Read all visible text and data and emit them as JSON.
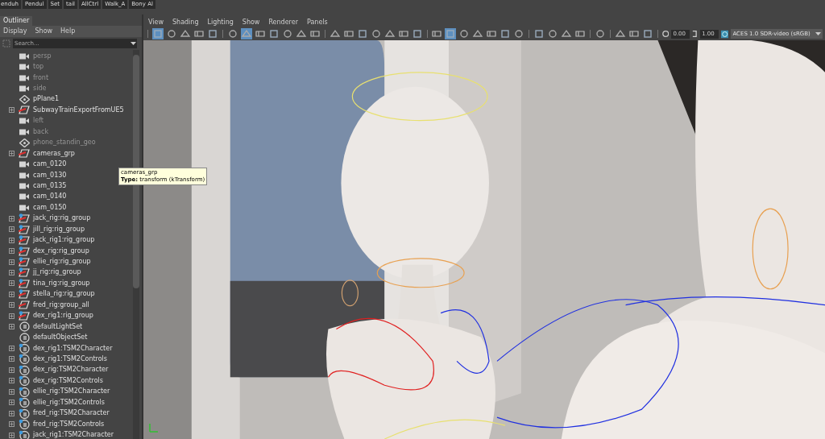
{
  "shelf": [
    "enduh",
    "Pendul",
    "Set",
    "tail",
    "AllCtrl",
    "Walk_A",
    "Bony Al"
  ],
  "outliner": {
    "tab": "Outliner",
    "menu": [
      "Display",
      "Show",
      "Help"
    ],
    "search": {
      "placeholder": "Search..."
    },
    "items": [
      {
        "label": "persp",
        "kind": "camera",
        "dimmed": true,
        "expandable": false
      },
      {
        "label": "top",
        "kind": "camera",
        "dimmed": true,
        "expandable": false
      },
      {
        "label": "front",
        "kind": "camera",
        "dimmed": true,
        "expandable": false
      },
      {
        "label": "side",
        "kind": "camera",
        "dimmed": true,
        "expandable": false
      },
      {
        "label": "pPlane1",
        "kind": "mesh",
        "dimmed": false,
        "expandable": false
      },
      {
        "label": "SubwayTrainExportFromUE5",
        "kind": "group",
        "dimmed": false,
        "expandable": true
      },
      {
        "label": "left",
        "kind": "camera",
        "dimmed": true,
        "expandable": false
      },
      {
        "label": "back",
        "kind": "camera",
        "dimmed": true,
        "expandable": false
      },
      {
        "label": "phone_standin_geo",
        "kind": "mesh",
        "dimmed": true,
        "expandable": false
      },
      {
        "label": "cameras_grp",
        "kind": "group",
        "dimmed": false,
        "expandable": true
      },
      {
        "label": "cam_0120",
        "kind": "camera",
        "dimmed": false,
        "expandable": false
      },
      {
        "label": "cam_0130",
        "kind": "camera",
        "dimmed": false,
        "expandable": false
      },
      {
        "label": "cam_0135",
        "kind": "camera",
        "dimmed": false,
        "expandable": false
      },
      {
        "label": "cam_0140",
        "kind": "camera",
        "dimmed": false,
        "expandable": false
      },
      {
        "label": "cam_0150",
        "kind": "camera",
        "dimmed": false,
        "expandable": false
      },
      {
        "label": "jack_rig:rig_group",
        "kind": "rig",
        "dimmed": false,
        "expandable": true
      },
      {
        "label": "jill_rig:rig_group",
        "kind": "rig",
        "dimmed": false,
        "expandable": true
      },
      {
        "label": "jack_rig1:rig_group",
        "kind": "rig",
        "dimmed": false,
        "expandable": true
      },
      {
        "label": "dex_rig:rig_group",
        "kind": "rig",
        "dimmed": false,
        "expandable": true
      },
      {
        "label": "ellie_rig:rig_group",
        "kind": "rig",
        "dimmed": false,
        "expandable": true
      },
      {
        "label": "jj_rig:rig_group",
        "kind": "rig",
        "dimmed": false,
        "expandable": true
      },
      {
        "label": "tina_rig:rig_group",
        "kind": "rig",
        "dimmed": false,
        "expandable": true
      },
      {
        "label": "stella_rig:rig_group",
        "kind": "rig",
        "dimmed": false,
        "expandable": true
      },
      {
        "label": "fred_rig:group_all",
        "kind": "group",
        "dimmed": false,
        "expandable": true
      },
      {
        "label": "dex_rig1:rig_group",
        "kind": "rig",
        "dimmed": false,
        "expandable": true
      },
      {
        "label": "defaultLightSet",
        "kind": "set",
        "dimmed": false,
        "expandable": true
      },
      {
        "label": "defaultObjectSet",
        "kind": "set",
        "dimmed": false,
        "expandable": false
      },
      {
        "label": "dex_rig1:TSM2Character",
        "kind": "refset",
        "dimmed": false,
        "expandable": true
      },
      {
        "label": "dex_rig1:TSM2Controls",
        "kind": "refset",
        "dimmed": false,
        "expandable": true
      },
      {
        "label": "dex_rig:TSM2Character",
        "kind": "refset",
        "dimmed": false,
        "expandable": true
      },
      {
        "label": "dex_rig:TSM2Controls",
        "kind": "refset",
        "dimmed": false,
        "expandable": true
      },
      {
        "label": "ellie_rig:TSM2Character",
        "kind": "refset",
        "dimmed": false,
        "expandable": true
      },
      {
        "label": "ellie_rig:TSM2Controls",
        "kind": "refset",
        "dimmed": false,
        "expandable": true
      },
      {
        "label": "fred_rig:TSM2Character",
        "kind": "refset",
        "dimmed": false,
        "expandable": true
      },
      {
        "label": "fred_rig:TSM2Controls",
        "kind": "refset",
        "dimmed": false,
        "expandable": true
      },
      {
        "label": "jack_rig1:TSM2Character",
        "kind": "refset",
        "dimmed": false,
        "expandable": true
      }
    ],
    "tooltip": {
      "title": "cameras_grp",
      "type_label": "Type:",
      "type_value": "transform (kTransform)"
    }
  },
  "viewport": {
    "menu": [
      "View",
      "Shading",
      "Lighting",
      "Show",
      "Renderer",
      "Panels"
    ],
    "toolbar": [
      [
        true,
        false,
        false,
        false,
        false
      ],
      [
        false,
        true,
        false,
        false,
        false,
        false,
        false
      ],
      [
        false,
        false,
        false,
        false,
        false,
        false,
        false
      ],
      [
        false,
        true,
        false,
        false,
        false,
        false,
        false
      ],
      [
        false,
        false,
        false,
        false
      ],
      [
        false
      ],
      [
        false,
        false,
        false
      ]
    ],
    "exposure": "0.00",
    "gamma": "1.00",
    "color_space": "ACES 1.0 SDR-video (sRGB)"
  }
}
